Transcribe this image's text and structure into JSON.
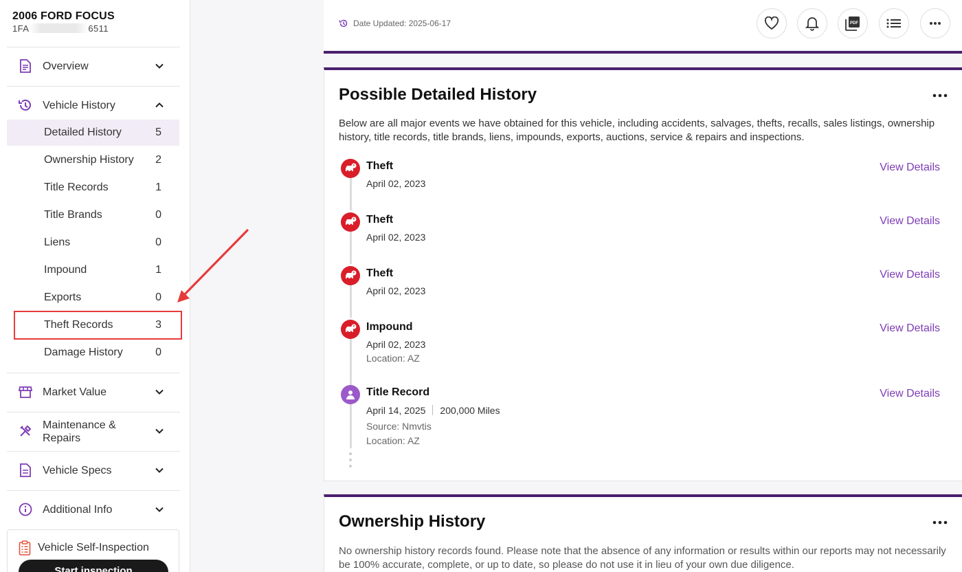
{
  "vehicle": {
    "title": "2006 FORD FOCUS",
    "vin_prefix": "1FA",
    "vin_suffix": "6511"
  },
  "sidebar": {
    "sections": [
      {
        "label": "Overview",
        "icon": "document-icon"
      },
      {
        "label": "Vehicle History",
        "icon": "history-icon"
      },
      {
        "label": "Market Value",
        "icon": "store-icon"
      },
      {
        "label": "Maintenance &",
        "label2": "Repairs",
        "icon": "tools-icon"
      },
      {
        "label": "Vehicle Specs",
        "icon": "specs-icon"
      },
      {
        "label": "Additional Info",
        "icon": "info-icon"
      }
    ],
    "history_items": [
      {
        "label": "Detailed History",
        "count": "5"
      },
      {
        "label": "Ownership History",
        "count": "2"
      },
      {
        "label": "Title Records",
        "count": "1"
      },
      {
        "label": "Title Brands",
        "count": "0"
      },
      {
        "label": "Liens",
        "count": "0"
      },
      {
        "label": "Impound",
        "count": "1"
      },
      {
        "label": "Exports",
        "count": "0"
      },
      {
        "label": "Theft Records",
        "count": "3"
      },
      {
        "label": "Damage History",
        "count": "0"
      }
    ],
    "inspection": {
      "label": "Vehicle Self-Inspection",
      "button": "Start inspection"
    }
  },
  "topbar": {
    "date_updated": "Date Updated: 2025-06-17"
  },
  "detailed": {
    "title": "Possible Detailed History",
    "description": "Below are all major events we have obtained for this vehicle, including accidents, salvages, thefts, recalls, sales listings, ownership history, title records, title brands, liens, impounds, exports, auctions, service & repairs and inspections.",
    "link_label": "View Details",
    "events": [
      {
        "title": "Theft",
        "date": "April 02, 2023"
      },
      {
        "title": "Theft",
        "date": "April 02, 2023"
      },
      {
        "title": "Theft",
        "date": "April 02, 2023"
      },
      {
        "title": "Impound",
        "date": "April 02, 2023",
        "location": "Location: AZ"
      },
      {
        "title": "Title Record",
        "date": "April 14, 2025",
        "miles": "200,000 Miles",
        "source": "Source: Nmvtis",
        "location": "Location: AZ"
      }
    ]
  },
  "ownership": {
    "title": "Ownership History",
    "description": "No ownership history records found. Please note that the absence of any information or results within our reports may not necessarily be 100% accurate, complete, or up to date, so please do not use it in lieu of your own due diligence."
  },
  "colors": {
    "accent": "#7d3cb5",
    "brand": "#4b1f6e",
    "alert": "#d91e2a",
    "annotation": "#e53b3b"
  }
}
